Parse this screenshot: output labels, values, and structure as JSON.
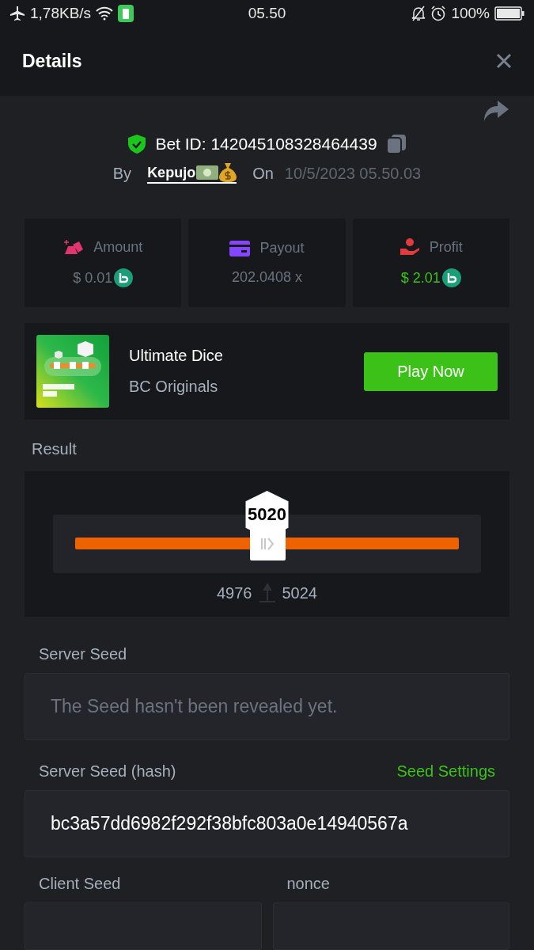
{
  "status_bar": {
    "speed": "1,78KB/s",
    "time": "05.50",
    "battery": "100%"
  },
  "header": {
    "title": "Details"
  },
  "bet": {
    "id_label": "Bet ID: 142045108328464439",
    "by_label": "By",
    "user": "Kepujo",
    "on_label": "On",
    "date": "10/5/2023 05.50.03"
  },
  "stats": [
    {
      "kind": "amount",
      "label": "Amount",
      "value": "$ 0.01",
      "coin": true,
      "positive": false
    },
    {
      "kind": "payout",
      "label": "Payout",
      "value": "202.0408 x",
      "coin": false,
      "positive": false
    },
    {
      "kind": "profit",
      "label": "Profit",
      "value": "$ 2.01",
      "coin": true,
      "positive": true
    }
  ],
  "game": {
    "title": "Ultimate Dice",
    "subtitle": "BC Originals",
    "button": "Play Now"
  },
  "result": {
    "label": "Result",
    "value": "5020",
    "level": 0.5,
    "low": "4976",
    "high": "5024"
  },
  "server_seed": {
    "label": "Server Seed",
    "placeholder": "The Seed hasn't been revealed yet."
  },
  "server_hash": {
    "label": "Server Seed (hash)",
    "link": "Seed Settings",
    "value": "bc3a57dd6982f292f38bfc803a0e14940567a"
  },
  "client_seed": {
    "label": "Client Seed"
  },
  "nonce": {
    "label": "nonce"
  }
}
